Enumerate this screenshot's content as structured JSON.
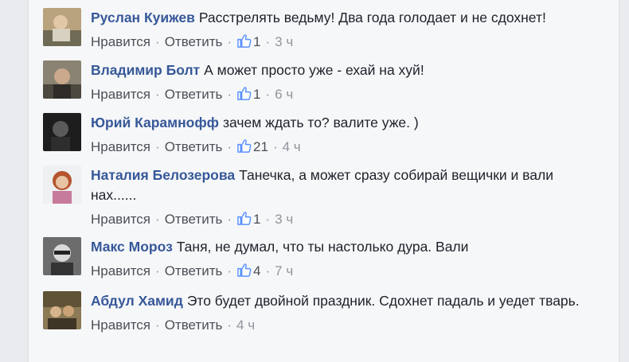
{
  "actions": {
    "like_label": "Нравится",
    "reply_label": "Ответить",
    "separator": "·"
  },
  "comments": [
    {
      "author": "Руслан Куижев",
      "text": "Расстрелять ведьму! Два года голодает и не сдохнет!",
      "likes": "1",
      "time": "3 ч"
    },
    {
      "author": "Владимир Болт",
      "text": "А может просто уже - ехай на хуй!",
      "likes": "1",
      "time": "6 ч"
    },
    {
      "author": "Юрий Карамнофф",
      "text": "зачем ждать то? валите уже. )",
      "likes": "21",
      "time": "4 ч"
    },
    {
      "author": "Наталия Белозерова",
      "text": "Танечка, а может сразу собирай вещички и вали нах......",
      "likes": "1",
      "time": "3 ч"
    },
    {
      "author": "Макс Мороз",
      "text": "Таня, не думал, что ты настолько дура. Вали",
      "likes": "4",
      "time": "7 ч"
    },
    {
      "author": "Абдул Хамид",
      "text": "Это будет двойной праздник. Сдохнет падаль и уедет тварь.",
      "time": "4 ч"
    }
  ],
  "colors": {
    "author": "#365899",
    "meta": "#90949c",
    "like_icon": "#5890ff"
  }
}
